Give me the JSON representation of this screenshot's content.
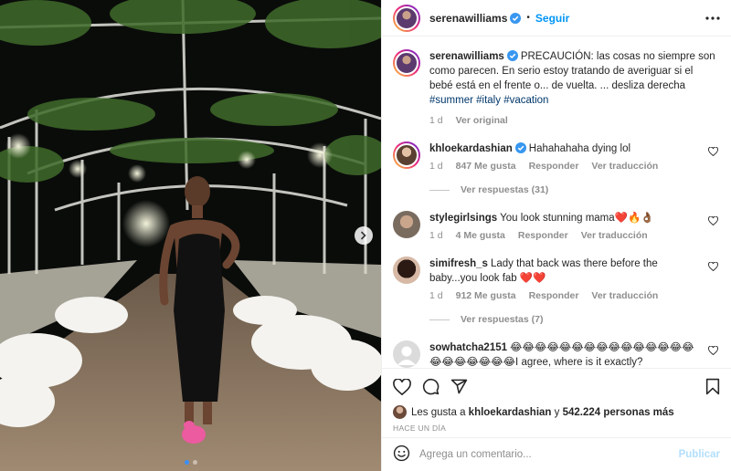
{
  "header": {
    "username": "serenawilliams",
    "separator": "•",
    "follow_label": "Seguir"
  },
  "caption": {
    "username": "serenawilliams",
    "text": "PRECAUCIÓN: las cosas no siempre son como parecen. En serio estoy tratando de averiguar si el bebé está en el frente o... de vuelta. ... desliza derecha",
    "tags": [
      "#summer",
      "#italy",
      "#vacation"
    ],
    "time": "1 d",
    "see_original": "Ver original"
  },
  "comments": [
    {
      "username": "khloekardashian",
      "verified": true,
      "text": "Hahahahaha dying lol",
      "time": "1 d",
      "likes": "847 Me gusta",
      "reply": "Responder",
      "translate": "Ver traducción",
      "view_replies": "Ver respuestas (31)"
    },
    {
      "username": "stylegirlsings",
      "verified": false,
      "text": "You look stunning mama❤️🔥👌🏾",
      "time": "1 d",
      "likes": "4 Me gusta",
      "reply": "Responder",
      "translate": "Ver traducción"
    },
    {
      "username": "simifresh_s",
      "verified": false,
      "text": "Lady that back was there before the baby...you look fab ❤️❤️",
      "time": "1 d",
      "likes": "912 Me gusta",
      "reply": "Responder",
      "translate": "Ver traducción",
      "view_replies": "Ver respuestas (7)"
    },
    {
      "username": "sowhatcha2151",
      "verified": false,
      "text": "😂😂😂😂😂😂😂😂😂😂😂😂😂😂😂😂😂😂😂😂😂😂I agree, where is it exactly?"
    }
  ],
  "likes": {
    "prefix": "Les gusta a",
    "user": "khloekardashian",
    "middle": "y",
    "count": "542.224 personas más"
  },
  "posted": "HACE UN DÍA",
  "composer": {
    "placeholder": "Agrega un comentario...",
    "post_label": "Publicar"
  },
  "carousel": {
    "slides": 2,
    "active": 1
  },
  "colors": {
    "accent": "#0095f6",
    "verified": "#3897f0",
    "muted": "#8e8e8e"
  },
  "icons": [
    "verified-icon",
    "more-options-icon",
    "heart-icon",
    "comment-icon",
    "share-icon",
    "bookmark-icon",
    "emoji-icon",
    "chevron-right-icon"
  ]
}
